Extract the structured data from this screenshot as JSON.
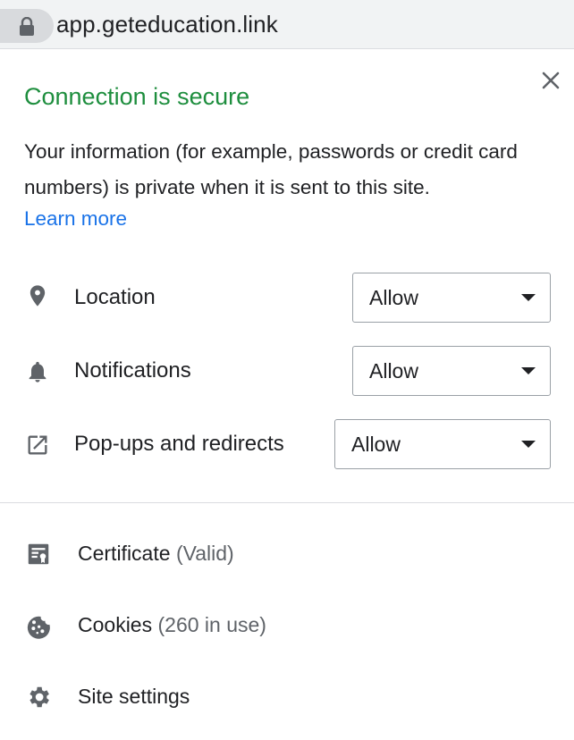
{
  "urlbar": {
    "url": "app.geteducation.link",
    "lock_icon": "lock-icon"
  },
  "popup": {
    "title": "Connection is secure",
    "description": "Your information (for example, passwords or credit card numbers) is private when it is sent to this site.",
    "learn_more": "Learn more",
    "permissions": [
      {
        "label": "Location",
        "value": "Allow",
        "icon": "location-pin-icon"
      },
      {
        "label": "Notifications",
        "value": "Allow",
        "icon": "bell-icon"
      },
      {
        "label": "Pop-ups and redirects",
        "value": "Allow",
        "icon": "open-in-new-icon"
      }
    ],
    "info": [
      {
        "label": "Certificate",
        "extra": "(Valid)",
        "icon": "certificate-icon"
      },
      {
        "label": "Cookies",
        "extra": "(260 in use)",
        "icon": "cookie-icon"
      },
      {
        "label": "Site settings",
        "extra": "",
        "icon": "gear-icon"
      }
    ]
  },
  "colors": {
    "title_green": "#1e8e3e",
    "link_blue": "#1a73e8",
    "icon_gray": "#5f6368"
  }
}
